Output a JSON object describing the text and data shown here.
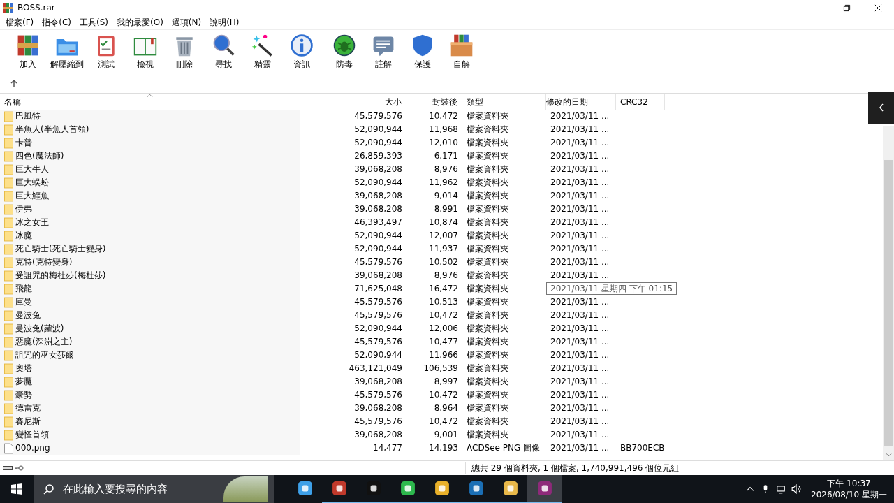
{
  "window": {
    "title": "BOSS.rar"
  },
  "menu": [
    "檔案(F)",
    "指令(C)",
    "工具(S)",
    "我的最愛(O)",
    "選項(N)",
    "說明(H)"
  ],
  "toolbar": [
    {
      "label": "加入",
      "kind": "add"
    },
    {
      "label": "解壓縮到",
      "kind": "extract"
    },
    {
      "label": "測試",
      "kind": "test"
    },
    {
      "label": "檢視",
      "kind": "view"
    },
    {
      "label": "刪除",
      "kind": "delete"
    },
    {
      "label": "尋找",
      "kind": "find"
    },
    {
      "label": "精靈",
      "kind": "wizard"
    },
    {
      "label": "資訊",
      "kind": "info"
    },
    {
      "label": "防毒",
      "kind": "virus",
      "group_start": true
    },
    {
      "label": "註解",
      "kind": "comment"
    },
    {
      "label": "保護",
      "kind": "protect"
    },
    {
      "label": "自解",
      "kind": "sfx"
    }
  ],
  "table": {
    "columns": [
      "名稱",
      "大小",
      "封裝後",
      "類型",
      "修改的日期",
      "CRC32"
    ],
    "rows": [
      {
        "kind": "folder",
        "name": "巴風特",
        "size": "45,579,576",
        "packed": "10,472",
        "type": "檔案資料夾",
        "modified": "2021/03/11 ..."
      },
      {
        "kind": "folder",
        "name": "半魚人(半魚人首領)",
        "size": "52,090,944",
        "packed": "11,968",
        "type": "檔案資料夾",
        "modified": "2021/03/11 ..."
      },
      {
        "kind": "folder",
        "name": "卡普",
        "size": "52,090,944",
        "packed": "12,010",
        "type": "檔案資料夾",
        "modified": "2021/03/11 ..."
      },
      {
        "kind": "folder",
        "name": "四色(魔法師)",
        "size": "26,859,393",
        "packed": "6,171",
        "type": "檔案資料夾",
        "modified": "2021/03/11 ..."
      },
      {
        "kind": "folder",
        "name": "巨大牛人",
        "size": "39,068,208",
        "packed": "8,976",
        "type": "檔案資料夾",
        "modified": "2021/03/11 ..."
      },
      {
        "kind": "folder",
        "name": "巨大蜈蚣",
        "size": "52,090,944",
        "packed": "11,962",
        "type": "檔案資料夾",
        "modified": "2021/03/11 ..."
      },
      {
        "kind": "folder",
        "name": "巨大鱷魚",
        "size": "39,068,208",
        "packed": "9,014",
        "type": "檔案資料夾",
        "modified": "2021/03/11 ..."
      },
      {
        "kind": "folder",
        "name": "伊弗",
        "size": "39,068,208",
        "packed": "8,991",
        "type": "檔案資料夾",
        "modified": "2021/03/11 ..."
      },
      {
        "kind": "folder",
        "name": "冰之女王",
        "size": "46,393,497",
        "packed": "10,874",
        "type": "檔案資料夾",
        "modified": "2021/03/11 ..."
      },
      {
        "kind": "folder",
        "name": "冰魔",
        "size": "52,090,944",
        "packed": "12,007",
        "type": "檔案資料夾",
        "modified": "2021/03/11 ..."
      },
      {
        "kind": "folder",
        "name": "死亡騎士(死亡騎士變身)",
        "size": "52,090,944",
        "packed": "11,937",
        "type": "檔案資料夾",
        "modified": "2021/03/11 ..."
      },
      {
        "kind": "folder",
        "name": "克特(克特變身)",
        "size": "45,579,576",
        "packed": "10,502",
        "type": "檔案資料夾",
        "modified": "2021/03/11 ..."
      },
      {
        "kind": "folder",
        "name": "受詛咒的梅杜莎(梅杜莎)",
        "size": "39,068,208",
        "packed": "8,976",
        "type": "檔案資料夾",
        "modified": "2021/03/11 ..."
      },
      {
        "kind": "folder",
        "name": "飛龍",
        "size": "71,625,048",
        "packed": "16,472",
        "type": "檔案資料夾",
        "modified": "2021/03/11 星期四 下午 01:15",
        "tooltip": true
      },
      {
        "kind": "folder",
        "name": "庫曼",
        "size": "45,579,576",
        "packed": "10,513",
        "type": "檔案資料夾",
        "modified": "2021/03/11 ..."
      },
      {
        "kind": "folder",
        "name": "曼波兔",
        "size": "45,579,576",
        "packed": "10,472",
        "type": "檔案資料夾",
        "modified": "2021/03/11 ..."
      },
      {
        "kind": "folder",
        "name": "曼波兔(蘿波)",
        "size": "52,090,944",
        "packed": "12,006",
        "type": "檔案資料夾",
        "modified": "2021/03/11 ..."
      },
      {
        "kind": "folder",
        "name": "惡魔(深淵之主)",
        "size": "45,579,576",
        "packed": "10,477",
        "type": "檔案資料夾",
        "modified": "2021/03/11 ..."
      },
      {
        "kind": "folder",
        "name": "詛咒的巫女莎爾",
        "size": "52,090,944",
        "packed": "11,966",
        "type": "檔案資料夾",
        "modified": "2021/03/11 ..."
      },
      {
        "kind": "folder",
        "name": "奧塔",
        "size": "463,121,049",
        "packed": "106,539",
        "type": "檔案資料夾",
        "modified": "2021/03/11 ..."
      },
      {
        "kind": "folder",
        "name": "夢魘",
        "size": "39,068,208",
        "packed": "8,997",
        "type": "檔案資料夾",
        "modified": "2021/03/11 ..."
      },
      {
        "kind": "folder",
        "name": "豪勢",
        "size": "45,579,576",
        "packed": "10,472",
        "type": "檔案資料夾",
        "modified": "2021/03/11 ..."
      },
      {
        "kind": "folder",
        "name": "德雷克",
        "size": "39,068,208",
        "packed": "8,964",
        "type": "檔案資料夾",
        "modified": "2021/03/11 ..."
      },
      {
        "kind": "folder",
        "name": "賽尼斯",
        "size": "45,579,576",
        "packed": "10,472",
        "type": "檔案資料夾",
        "modified": "2021/03/11 ..."
      },
      {
        "kind": "folder",
        "name": "變怪首領",
        "size": "39,068,208",
        "packed": "9,001",
        "type": "檔案資料夾",
        "modified": "2021/03/11 ..."
      },
      {
        "kind": "file",
        "name": "000.png",
        "size": "14,477",
        "packed": "14,193",
        "type": "ACDSee PNG 圖像",
        "modified": "2021/03/11 ...",
        "crc": "BB700ECB"
      }
    ]
  },
  "status_bar": {
    "text": "總共 29 個資料夾, 1 個檔案, 1,740,991,496 個位元組"
  },
  "taskbar": {
    "search": {
      "placeholder": "在此輸入要搜尋的內容"
    },
    "apps": [
      {
        "kind": "cube",
        "running": false,
        "selected": false
      },
      {
        "kind": "game",
        "running": true,
        "selected": false
      },
      {
        "kind": "penguin",
        "running": true,
        "selected": false
      },
      {
        "kind": "chat",
        "running": true,
        "selected": false
      },
      {
        "kind": "browser",
        "running": true,
        "selected": false
      },
      {
        "kind": "arrow",
        "running": true,
        "selected": false
      },
      {
        "kind": "folder",
        "running": true,
        "selected": false
      },
      {
        "kind": "archive",
        "running": true,
        "selected": true
      }
    ],
    "time": "下午 10:37",
    "date": "2026/08/10 星期一"
  }
}
